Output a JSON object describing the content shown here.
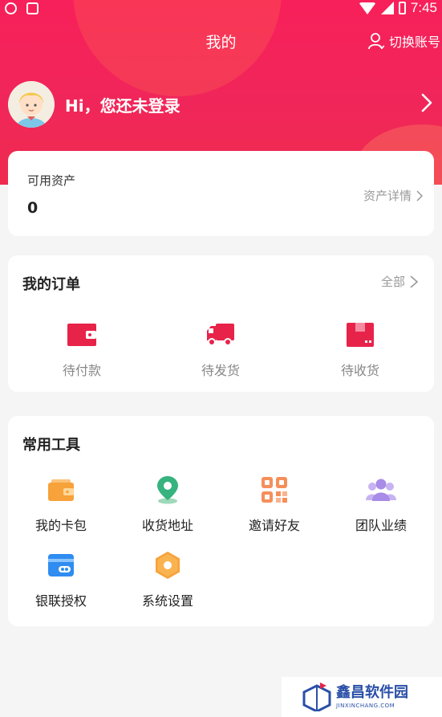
{
  "status_bar": {
    "time": "7:45"
  },
  "header": {
    "title": "我的",
    "switch_account": "切换账号"
  },
  "profile": {
    "greeting": "Hi，您还未登录"
  },
  "assets": {
    "label": "可用资产",
    "value": "0",
    "detail_link": "资产详情"
  },
  "orders": {
    "title": "我的订单",
    "all_link": "全部",
    "items": [
      {
        "label": "待付款",
        "icon": "wallet-icon"
      },
      {
        "label": "待发货",
        "icon": "truck-icon"
      },
      {
        "label": "待收货",
        "icon": "package-icon"
      }
    ]
  },
  "tools": {
    "title": "常用工具",
    "items": [
      {
        "label": "我的卡包",
        "icon": "card-wallet-icon"
      },
      {
        "label": "收货地址",
        "icon": "location-pin-icon"
      },
      {
        "label": "邀请好友",
        "icon": "qr-code-icon"
      },
      {
        "label": "团队业绩",
        "icon": "team-icon"
      },
      {
        "label": "银联授权",
        "icon": "bank-card-icon"
      },
      {
        "label": "系统设置",
        "icon": "settings-hexagon-icon"
      }
    ]
  },
  "watermark": {
    "name": "鑫昌软件园",
    "domain": "JINXINCHANG.COM"
  },
  "colors": {
    "brand": "#f0265a",
    "icon_red": "#e8234a",
    "tool_orange": "#f7a23a",
    "tool_green": "#36b37e",
    "tool_purple": "#a98be8",
    "tool_blue": "#2f8cf0"
  }
}
